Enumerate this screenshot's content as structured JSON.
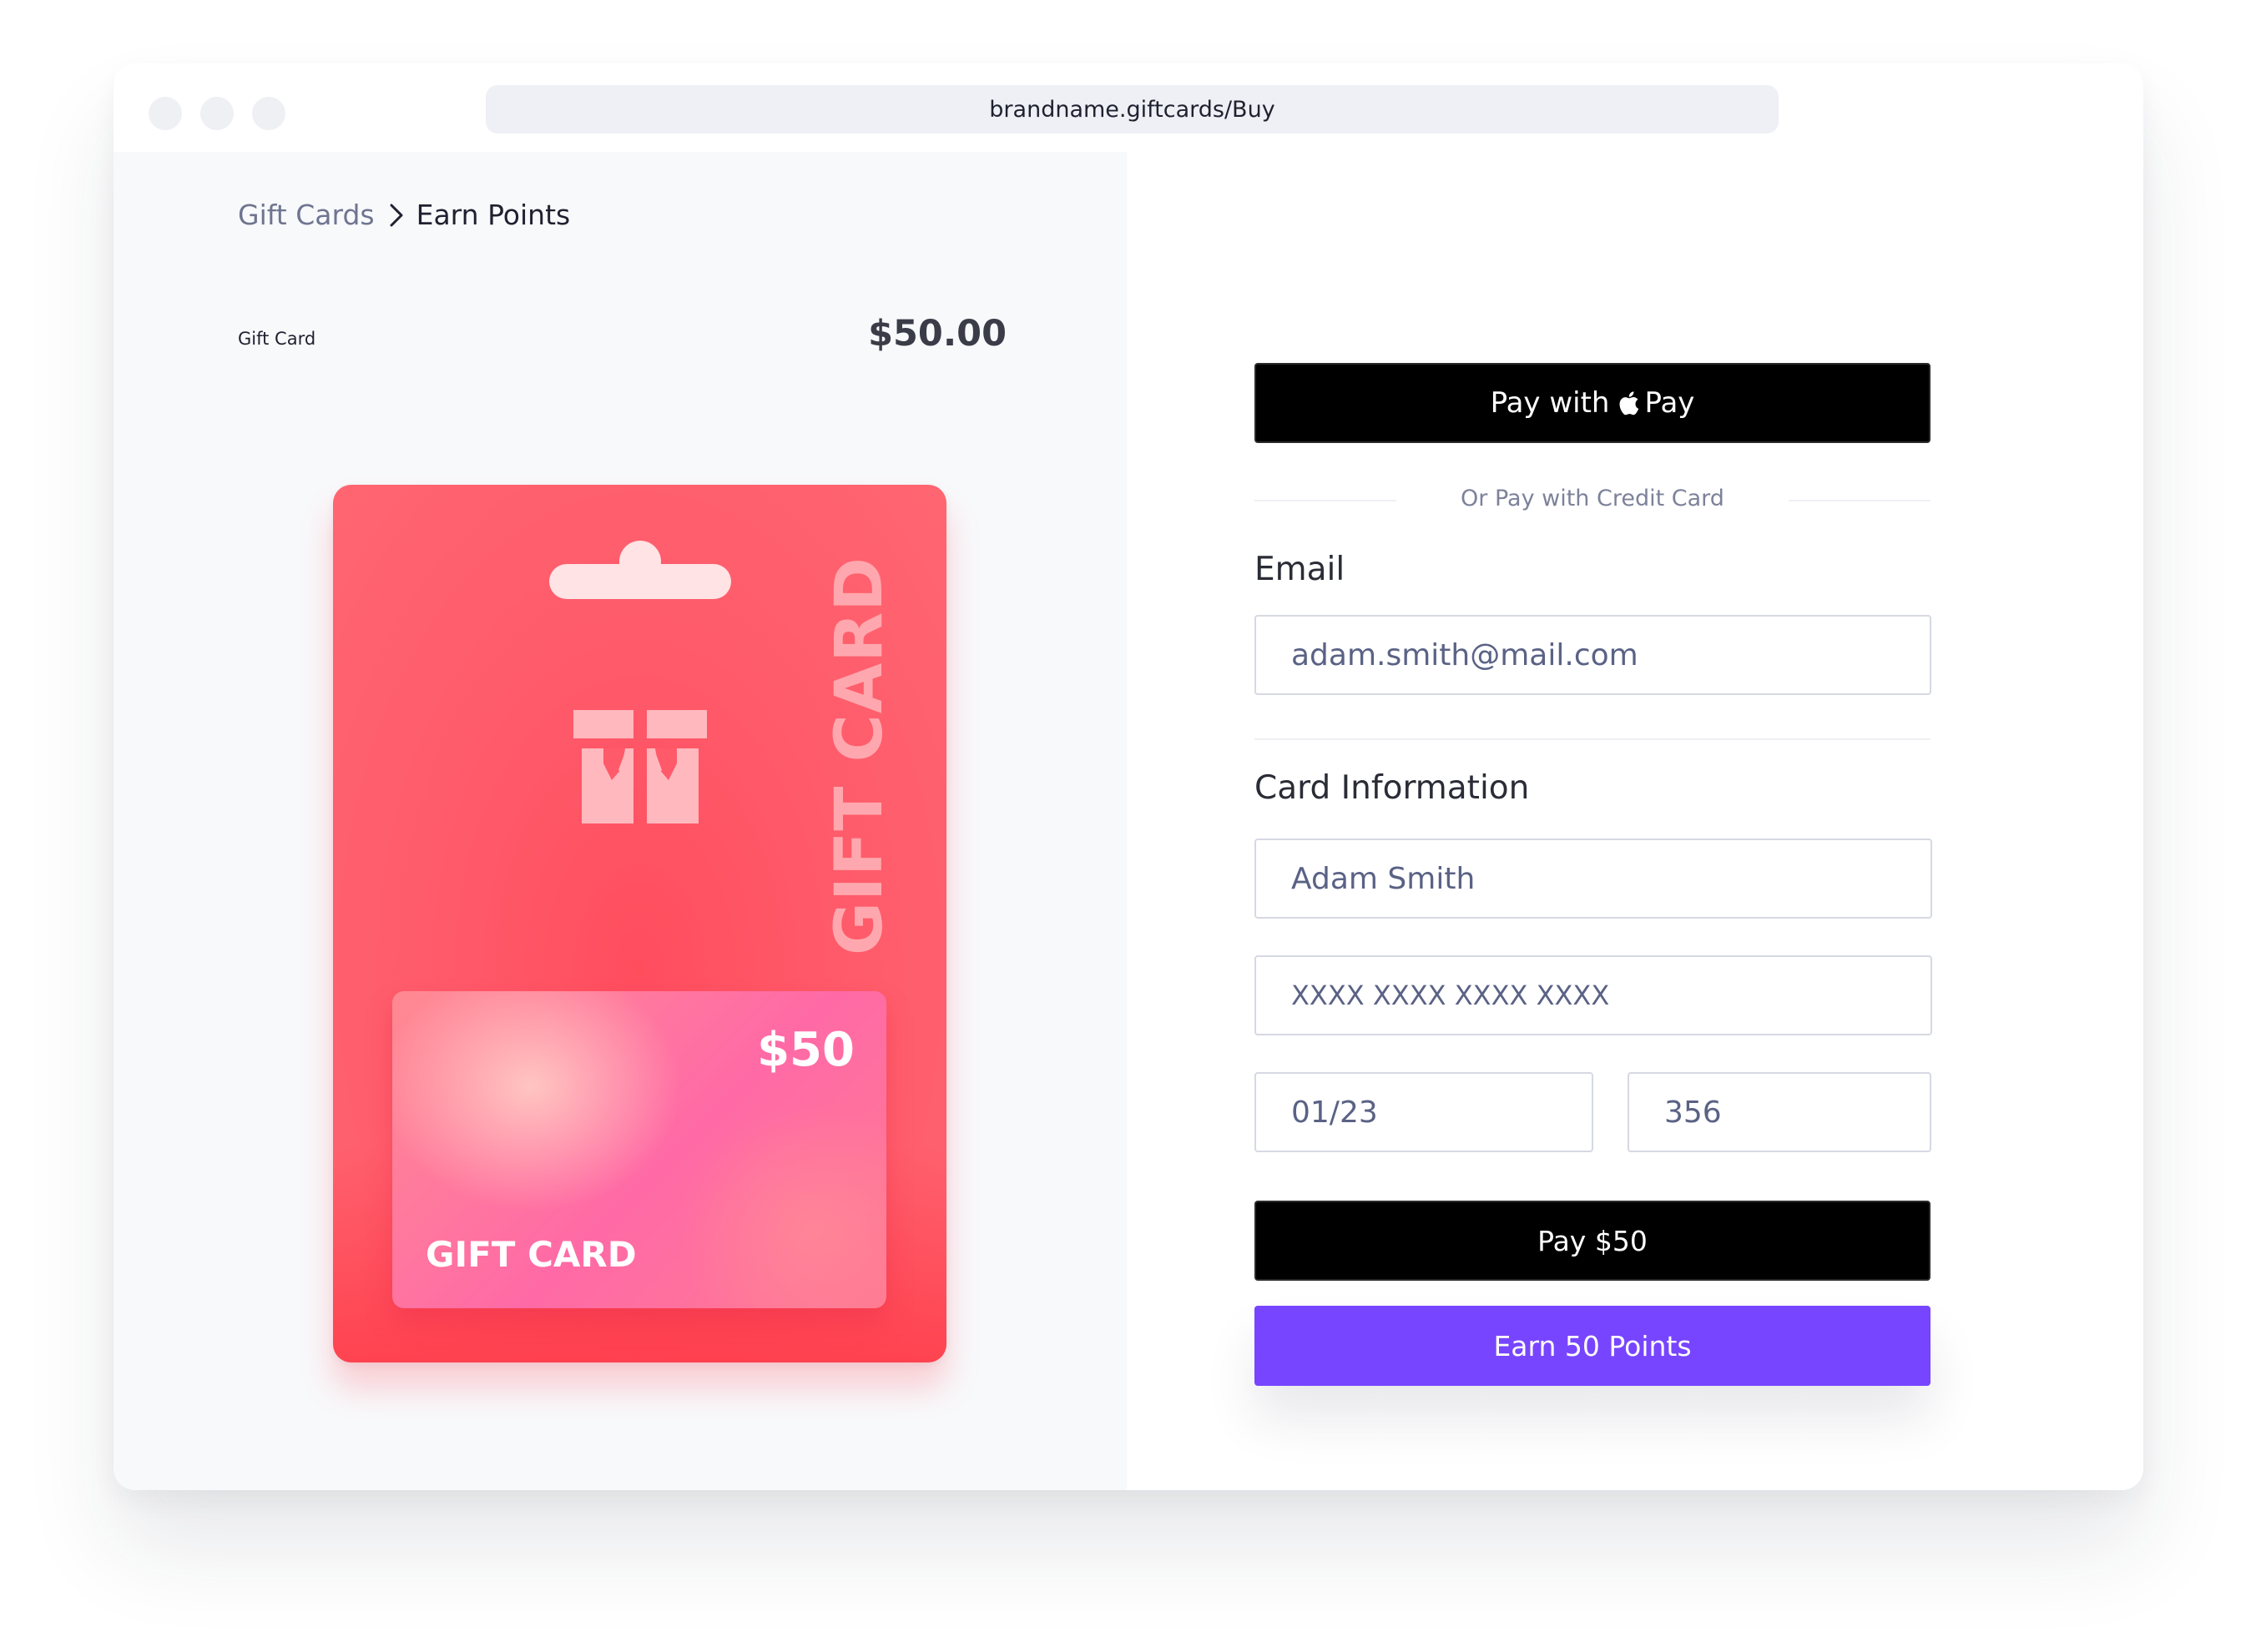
{
  "browser": {
    "url": "brandname.giftcards/Buy"
  },
  "breadcrumb": {
    "items": [
      "Gift Cards",
      "Earn Points"
    ]
  },
  "product": {
    "label": "Gift Card",
    "price": "$50.00"
  },
  "gift_card_art": {
    "vertical_text": "GIFT CARD",
    "card_value": "$50",
    "card_label": "GIFT CARD",
    "package_color": "#ff5a6a",
    "card_color": "#ff6aa6"
  },
  "checkout": {
    "applepay_prefix": "Pay with",
    "applepay_suffix": "Pay",
    "divider_text": "Or Pay with Credit Card",
    "email_label": "Email",
    "email_value": "adam.smith@mail.com",
    "card_section_label": "Card Information",
    "name_value": "Adam Smith",
    "card_number_value": "XXXX XXXX XXXX XXXX",
    "expiry_value": "01/23",
    "cvc_value": "356",
    "pay_button": "Pay $50",
    "earn_button": "Earn 50 Points"
  },
  "colors": {
    "accent": "#7745ff",
    "pay_button": "#000000"
  },
  "icons": {
    "breadcrumb_separator": "chevron-right-icon",
    "applepay": "apple-icon",
    "gift_logo": "gift-box-icon"
  }
}
